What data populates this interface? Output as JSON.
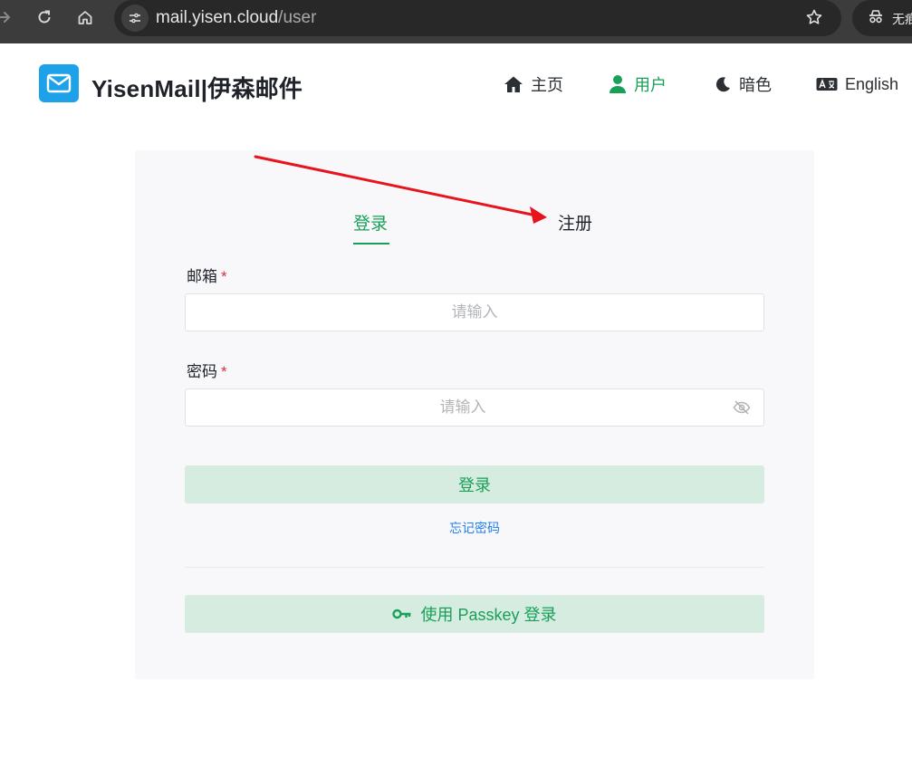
{
  "browser": {
    "url_host": "mail.yisen.cloud",
    "url_path": "/user",
    "profile_label": "无痕"
  },
  "header": {
    "title": "YisenMail|伊森邮件",
    "nav": {
      "home": "主页",
      "user": "用户",
      "dark": "暗色",
      "language": "English"
    }
  },
  "auth": {
    "tabs": {
      "login": "登录",
      "register": "注册"
    },
    "email": {
      "label": "邮箱",
      "required_mark": "*",
      "placeholder": "请输入"
    },
    "password": {
      "label": "密码",
      "required_mark": "*",
      "placeholder": "请输入"
    },
    "login_button": "登录",
    "forgot_link": "忘记密码",
    "passkey_button": "使用 Passkey 登录"
  },
  "colors": {
    "accent": "#18a058",
    "logo": "#1da1e8",
    "link": "#2080f0",
    "required": "#d03050",
    "annotation_arrow": "#e8141d"
  }
}
